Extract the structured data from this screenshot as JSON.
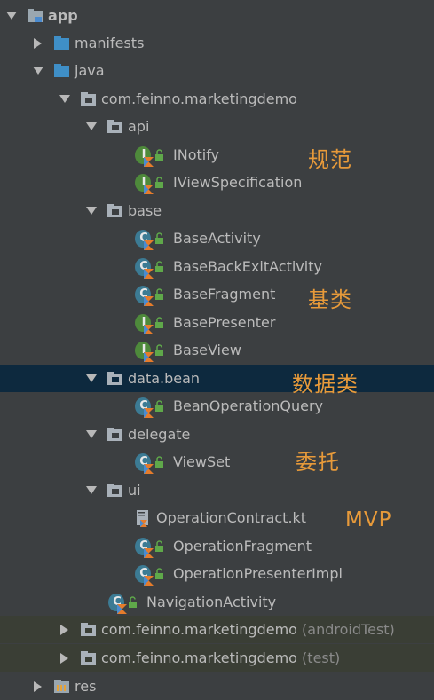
{
  "tree": {
    "app": "app",
    "manifests": "manifests",
    "java": "java",
    "pkg": "com.feinno.marketingdemo",
    "api": "api",
    "inotify": "INotify",
    "iviewspec": "IViewSpecification",
    "base": "base",
    "baseactivity": "BaseActivity",
    "basebackexit": "BaseBackExitActivity",
    "basefragment": "BaseFragment",
    "basepresenter": "BasePresenter",
    "baseview": "BaseView",
    "databean": "data.bean",
    "beanop": "BeanOperationQuery",
    "delegate": "delegate",
    "viewset": "ViewSet",
    "ui": "ui",
    "opcontract": "OperationContract.kt",
    "opfragment": "OperationFragment",
    "oppresenter": "OperationPresenterImpl",
    "navactivity": "NavigationActivity",
    "pkg_android": "com.feinno.marketingdemo",
    "pkg_android_suffix": "(androidTest)",
    "pkg_test": "com.feinno.marketingdemo",
    "pkg_test_suffix": "(test)",
    "res": "res"
  },
  "annotations": {
    "spec": "规范",
    "base": "基类",
    "data": "数据类",
    "delegate": "委托",
    "mvp": "MVP"
  },
  "colors": {
    "background": "#3c3f41",
    "selected_row": "#0d293e",
    "text": "#bbbbbb",
    "annotation": "#e79a3a",
    "folder_blue": "#3f8fc7",
    "class_icon": "#3c7b94",
    "interface_icon": "#4e8a3b"
  },
  "icons": {
    "expanded": "triangle-down-icon",
    "collapsed": "triangle-right-icon",
    "module": "module-folder-icon",
    "source_folder": "blue-folder-icon",
    "package": "package-icon",
    "class": "kotlin-class-icon",
    "interface": "kotlin-interface-icon",
    "kotlin_file": "kotlin-file-icon",
    "visibility": "public-lock-icon"
  }
}
